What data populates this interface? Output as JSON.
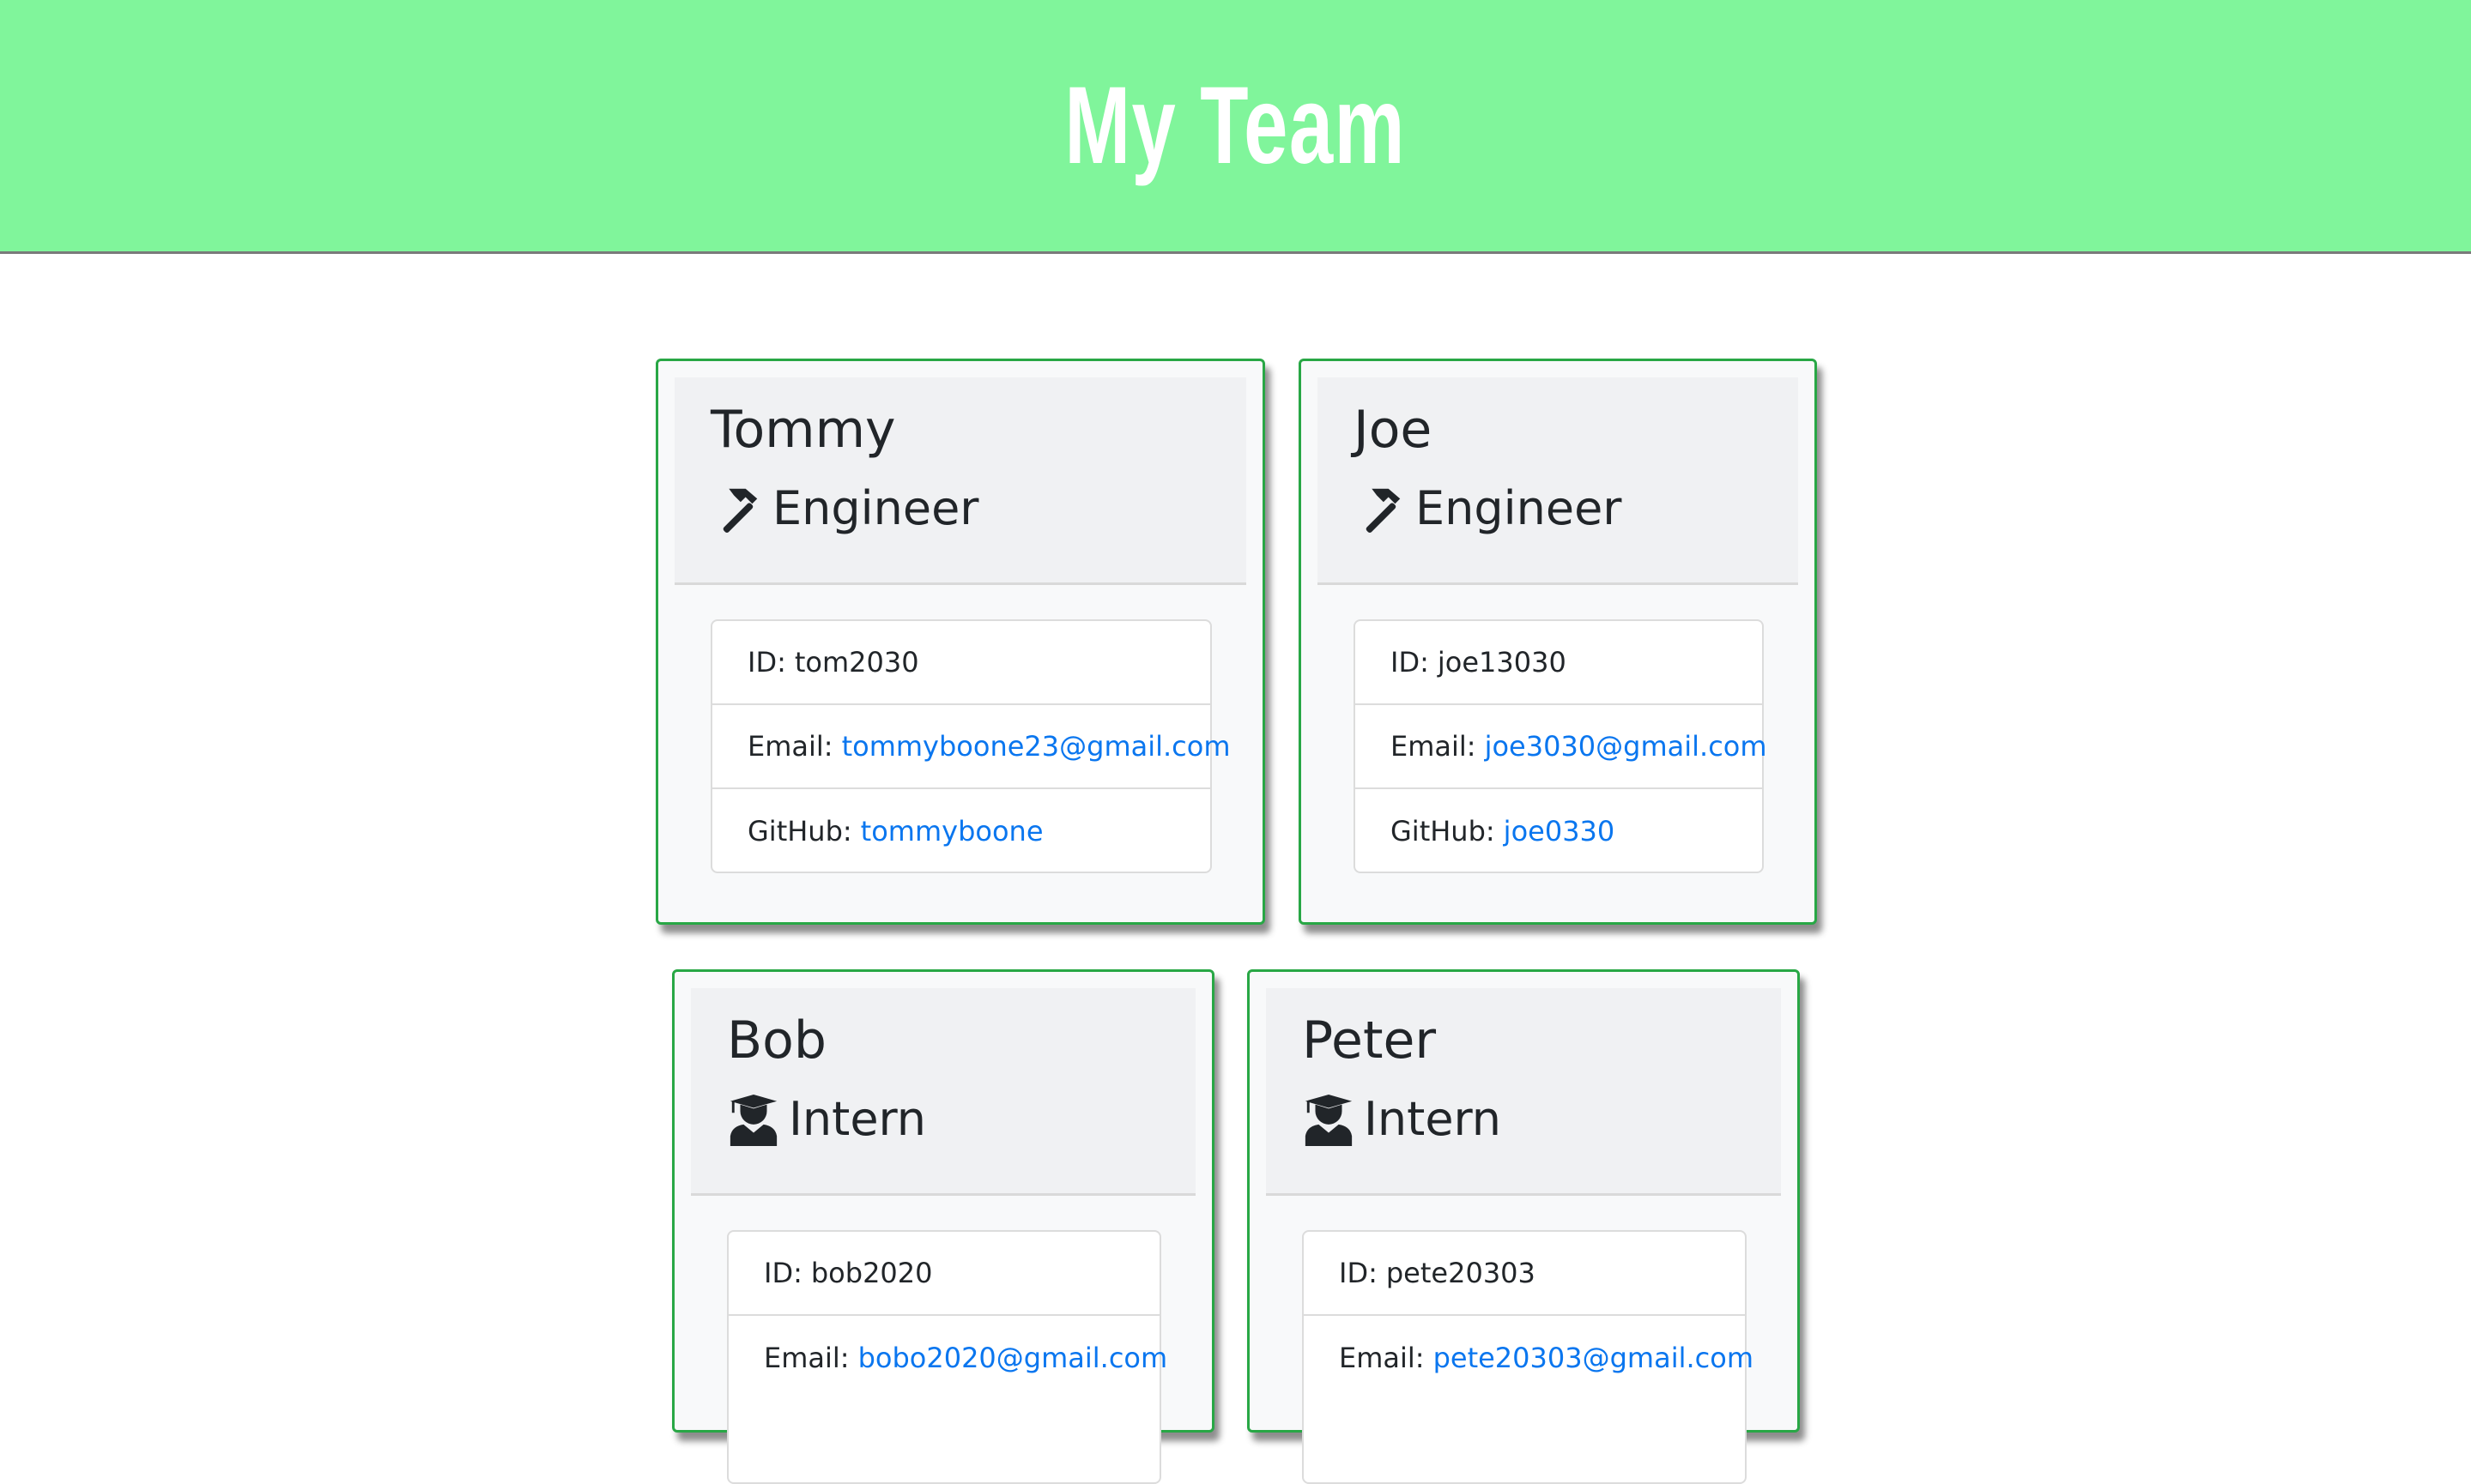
{
  "header": {
    "title": "My Team"
  },
  "labels": {
    "id": "ID:",
    "email": "Email:",
    "github": "GitHub:"
  },
  "colors": {
    "header_bg": "#80f59b",
    "card_border": "#28a745",
    "link": "#0a76ef"
  },
  "team": [
    {
      "name": "Tommy",
      "role": "Engineer",
      "icon": "hammer-icon",
      "id": "tom2030",
      "email": "tommyboone23@gmail.com",
      "github": "tommyboone"
    },
    {
      "name": "Joe",
      "role": "Engineer",
      "icon": "hammer-icon",
      "id": "joe13030",
      "email": "joe3030@gmail.com",
      "github": "joe0330"
    },
    {
      "name": "Bob",
      "role": "Intern",
      "icon": "graduate-icon",
      "id": "bob2020",
      "email": "bobo2020@gmail.com"
    },
    {
      "name": "Peter",
      "role": "Intern",
      "icon": "graduate-icon",
      "id": "pete20303",
      "email": "pete20303@gmail.com"
    }
  ]
}
